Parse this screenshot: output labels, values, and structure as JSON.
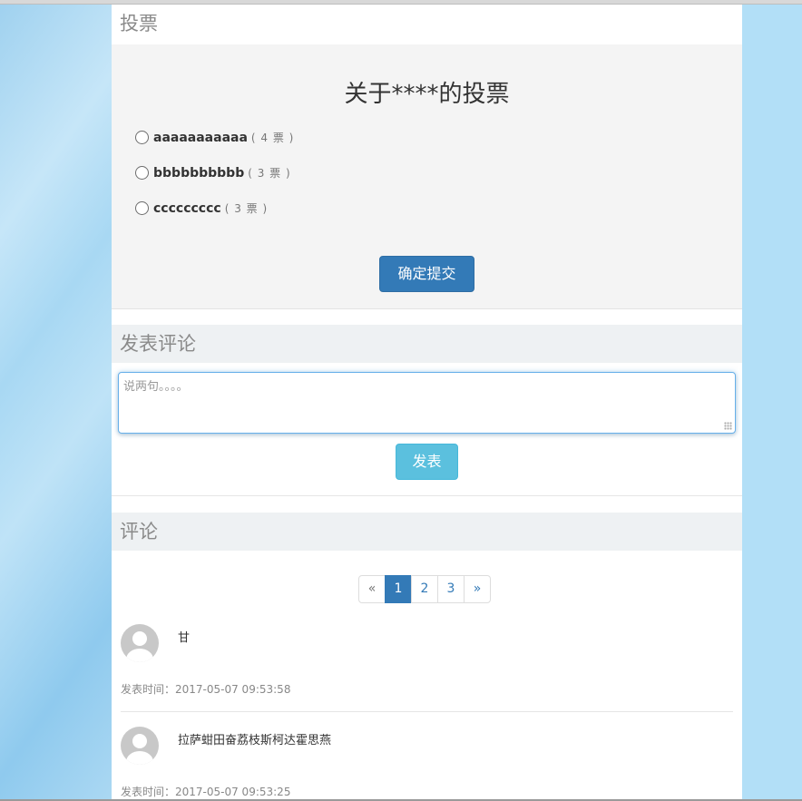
{
  "vote_section": {
    "heading": "投票",
    "title": "关于****的投票",
    "options": [
      {
        "label": "aaaaaaaaaaa",
        "count": "( 4 票 )"
      },
      {
        "label": "bbbbbbbbbb",
        "count": "( 3 票 )"
      },
      {
        "label": "ccccccccc",
        "count": "( 3 票 )"
      }
    ],
    "submit_label": "确定提交"
  },
  "post_section": {
    "heading": "发表评论",
    "placeholder": "说两句。。。。",
    "post_label": "发表"
  },
  "comments_section": {
    "heading": "评论",
    "pagination": {
      "prev": "«",
      "pages": [
        "1",
        "2",
        "3"
      ],
      "next": "»",
      "current": "1"
    },
    "comments": [
      {
        "text": "甘",
        "time": "发表时间：2017-05-07 09:53:58"
      },
      {
        "text": "拉萨蚶田奋荔枝斯柯达霍思燕",
        "time": "发表时间：2017-05-07 09:53:25"
      }
    ]
  },
  "colors": {
    "primary": "#337ab7",
    "info": "#5bc0de",
    "background": "#b2dff7"
  },
  "icons": {
    "avatar": "default-user-avatar-icon"
  }
}
